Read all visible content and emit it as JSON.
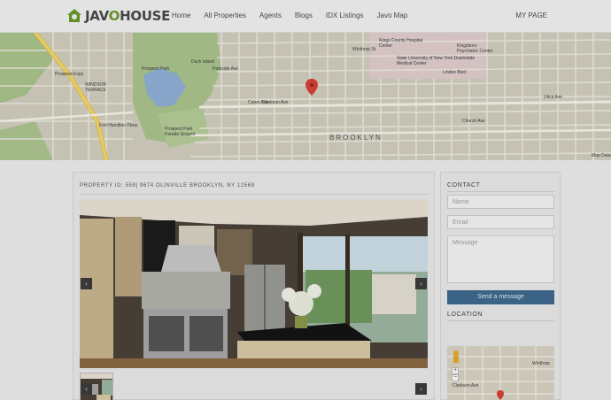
{
  "brand": {
    "logo_text_1": "JAV",
    "logo_text_2": "O",
    "logo_text_3": "HOUSE",
    "accent": "#6a9a2a"
  },
  "nav": {
    "items": [
      {
        "label": "Home"
      },
      {
        "label": "All Properties"
      },
      {
        "label": "Agents"
      },
      {
        "label": "Blogs"
      },
      {
        "label": "IDX Listings"
      },
      {
        "label": "Javo Map"
      }
    ],
    "mypage": "MY PAGE"
  },
  "map": {
    "labels": {
      "prospect_park": "Prospect Park",
      "duck_island": "Duck Island",
      "parkside_ave": "Parkside Ave",
      "winthrop": "Winthrop St",
      "kings_county": "Kings County Hospital Center",
      "kingsboro": "Kingsboro Psychiatric Center",
      "suny": "State University of New York Downstate Medical Center",
      "linden": "Linden Blvd",
      "church": "Church Ave",
      "brooklyn": "BROOKLYN",
      "prospect_expy": "Prospect Expy",
      "fort_hamilton": "Fort Hamilton Pkwy",
      "clarkson": "Clarkson Ave",
      "caton": "Caton Ave",
      "parade_ground": "Prospect Park Parade Ground",
      "windsor_terrace": "WINDSOR TERRACE",
      "utica": "Utica Ave",
      "map_data": "Map Data"
    },
    "pin_color": "#d64033"
  },
  "property": {
    "title": "PROPERTY ID: 559] 9674 OLINVILLE BROOKLYN, NY 12569",
    "prev_arrow": "‹",
    "next_arrow": "›",
    "thumb_prev": "‹",
    "thumb_next": "›"
  },
  "contact": {
    "title": "CONTACT",
    "name_placeholder": "Name",
    "email_placeholder": "Email",
    "message_placeholder": "Message",
    "send_label": "Send a message",
    "location_title": "LOCATION",
    "zoom_in": "+",
    "zoom_out": "−",
    "mini_clarkson": "Clarkson Ave",
    "mini_winthrop": "Winthrop",
    "button_color": "#3e6a8e"
  }
}
